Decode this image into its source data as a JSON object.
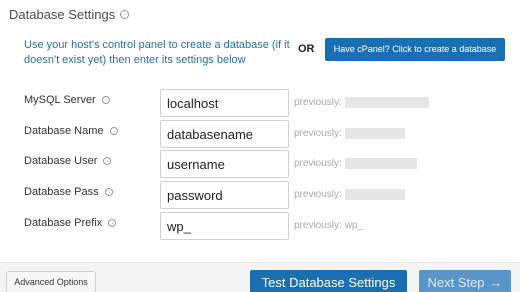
{
  "header": {
    "title": "Database Settings"
  },
  "intro": {
    "text": "Use your host's control panel to create a database (if it doesn't exist yet) then enter its settings below",
    "or_label": "OR",
    "cpanel_button": "Have cPanel? Click to create a database"
  },
  "fields": [
    {
      "label": "MySQL Server",
      "value": "localhost",
      "previous_label": "previously:",
      "previous_value": ""
    },
    {
      "label": "Database Name",
      "value": "databasename",
      "previous_label": "previously:",
      "previous_value": ""
    },
    {
      "label": "Database User",
      "value": "username",
      "previous_label": "previously:",
      "previous_value": ""
    },
    {
      "label": "Database Pass",
      "value": "password",
      "previous_label": "previously:",
      "previous_value": ""
    },
    {
      "label": "Database Prefix",
      "value": "wp_",
      "previous_label": "previously:",
      "previous_value": "wp_"
    }
  ],
  "footer": {
    "advanced_options": "Advanced Options",
    "test_button": "Test Database Settings",
    "next_button": "Next Step",
    "next_arrow": "→"
  },
  "colors": {
    "accent": "#1a6fb3",
    "link_text": "#2a6f9e",
    "disabled_button": "#5b94c8"
  },
  "icons": {
    "help": "help-circle-icon",
    "next": "arrow-right-icon"
  }
}
